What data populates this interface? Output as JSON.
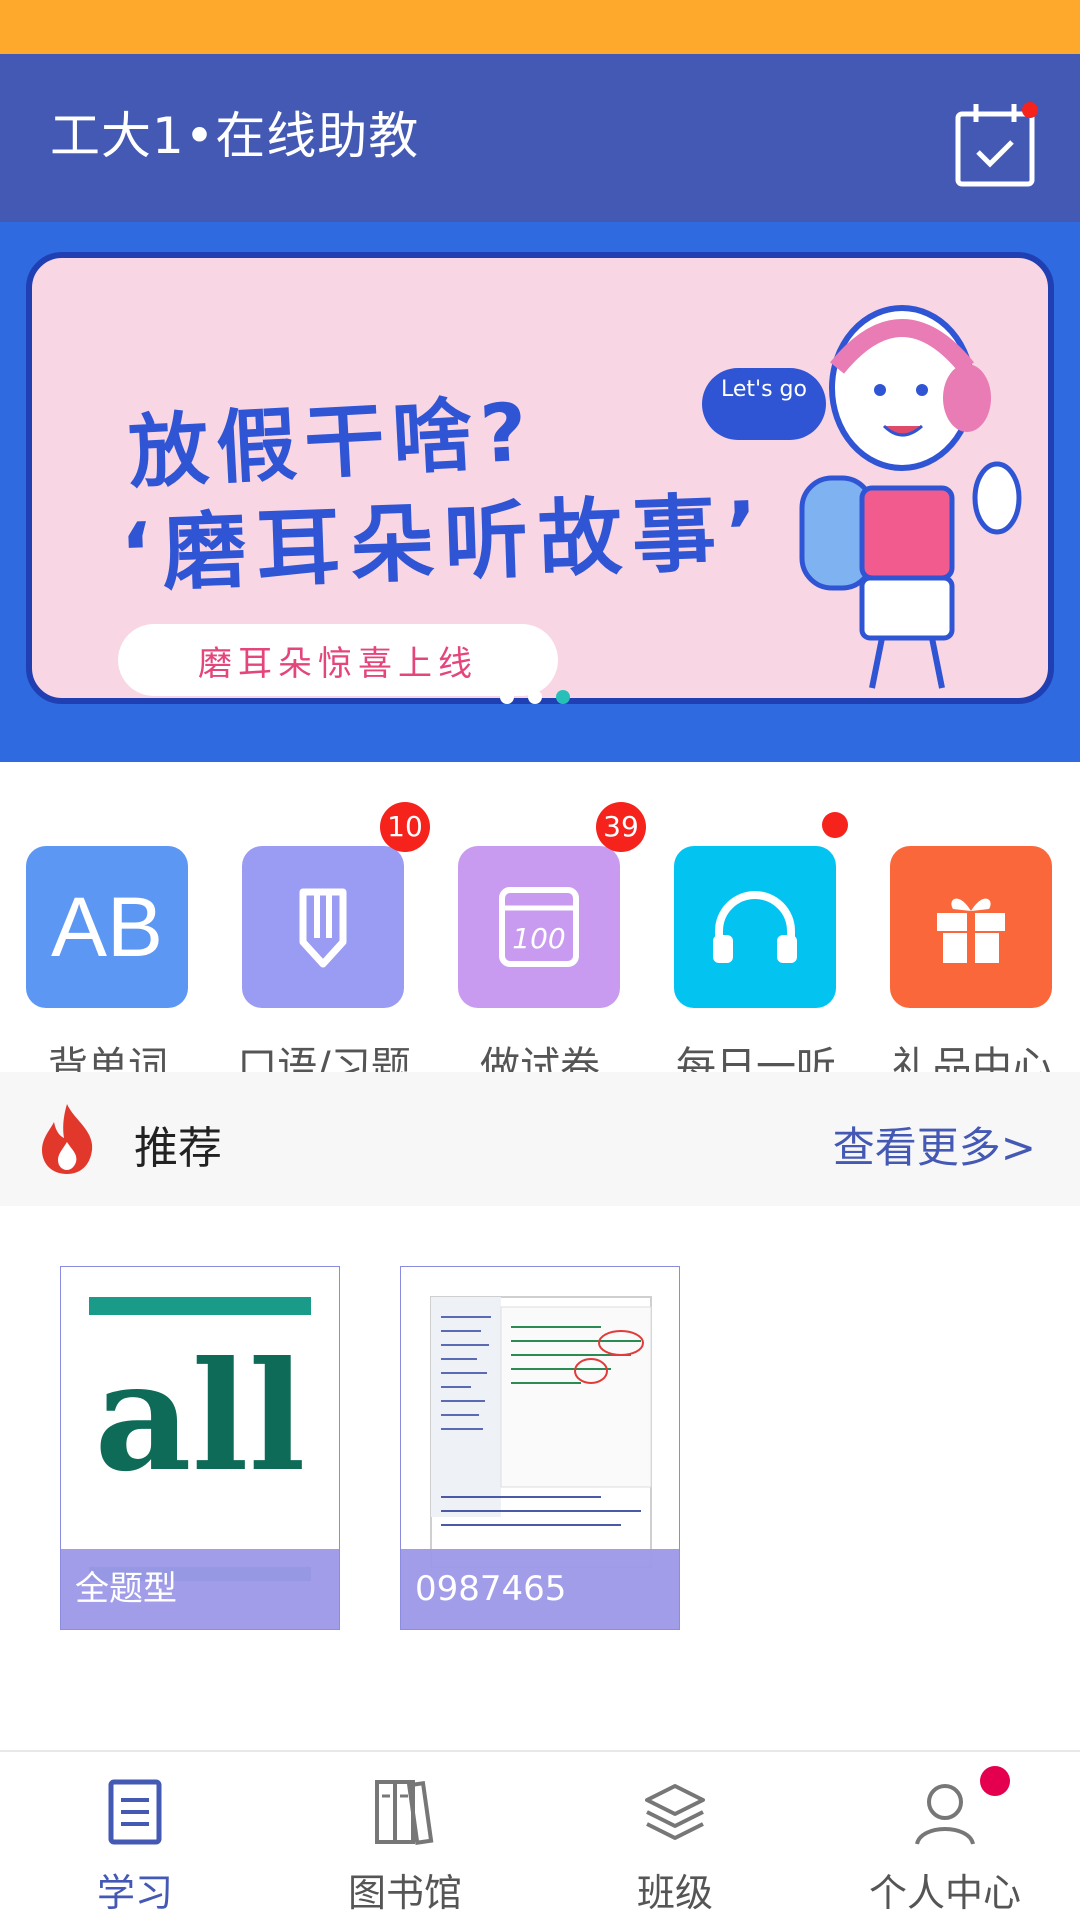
{
  "app_bar": {
    "title": "工大1•在线助教",
    "calendar_icon": "calendar-check-icon",
    "accent": "#4459B4",
    "status_bar_color": "#FEA92B"
  },
  "banner": {
    "headline_1": "放假干啥?",
    "headline_2": "‘磨耳朵听故事’",
    "pill_text": "磨耳朵惊喜上线",
    "bubble_text": "Let's go",
    "page_count": 3,
    "active_page": 3
  },
  "features": [
    {
      "label": "背单词",
      "icon": "ab-letters-icon",
      "color": "#5D97F4",
      "badge": ""
    },
    {
      "label": "口语/习题",
      "icon": "pencil-icon",
      "color": "#9A9BF3",
      "badge": "10"
    },
    {
      "label": "做试卷",
      "icon": "test-paper-icon",
      "color": "#C89BF0",
      "badge": "39"
    },
    {
      "label": "每日一听",
      "icon": "headphones-icon",
      "color": "#03C4F1",
      "badge": ""
    },
    {
      "label": "礼品中心",
      "icon": "gift-icon",
      "color": "#F9673A",
      "badge": ""
    }
  ],
  "recommend": {
    "title": "推荐",
    "more_label": "查看更多>",
    "fire_icon": "fire-icon",
    "items": [
      {
        "thumb_text": "all",
        "caption": "全题型"
      },
      {
        "caption": "0987465"
      }
    ]
  },
  "tabs": [
    {
      "label": "学习",
      "icon": "book-list-icon",
      "active": true
    },
    {
      "label": "图书馆",
      "icon": "library-icon",
      "active": false
    },
    {
      "label": "班级",
      "icon": "layers-icon",
      "active": false
    },
    {
      "label": "个人中心",
      "icon": "person-icon",
      "active": false
    }
  ]
}
